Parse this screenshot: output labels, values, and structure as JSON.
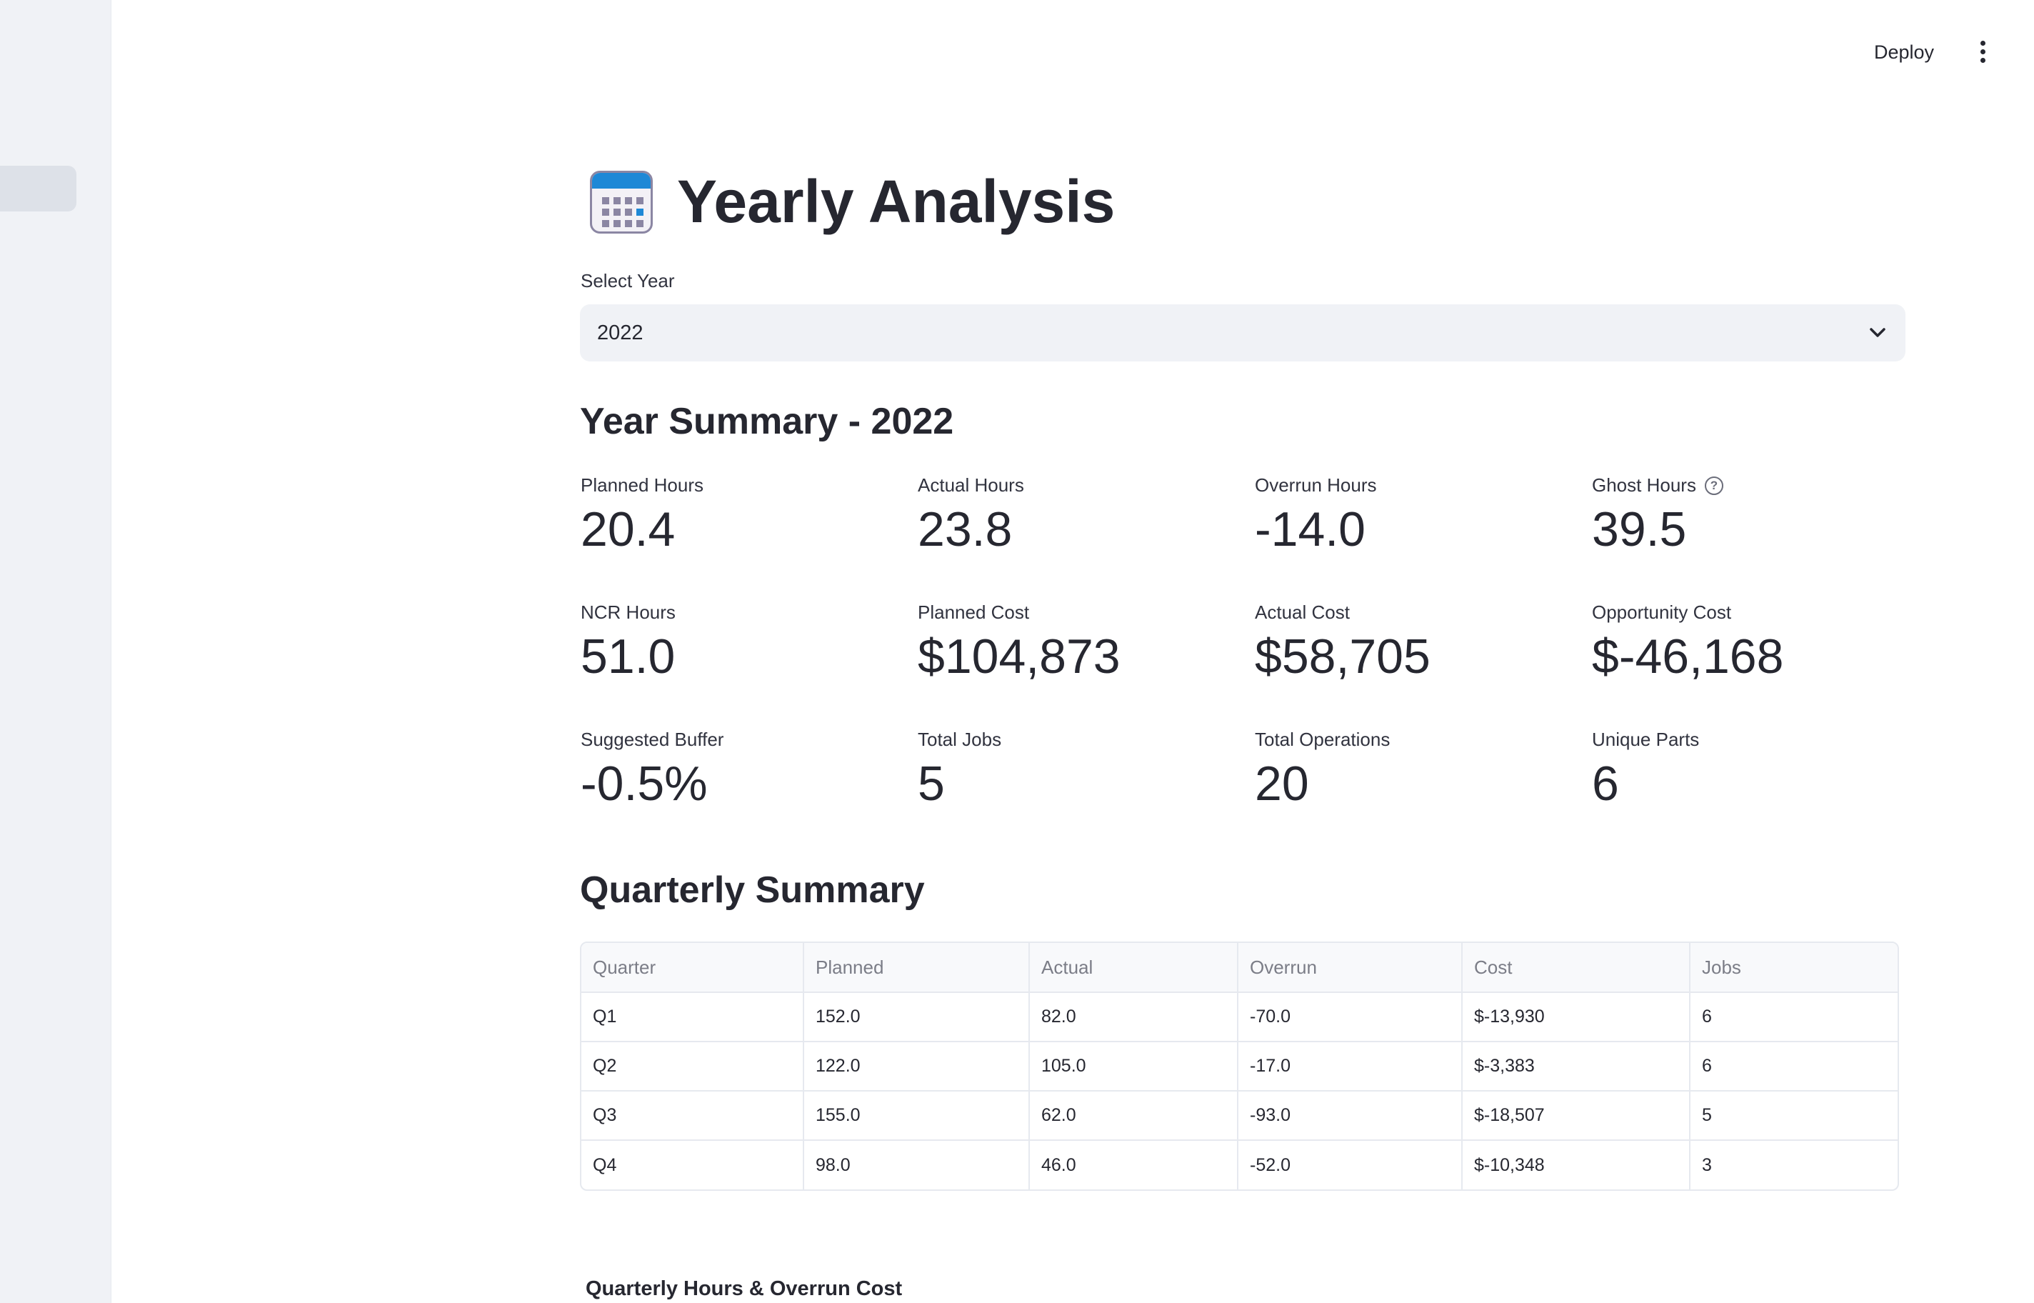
{
  "topbar": {
    "deploy_label": "Deploy",
    "menu_icon": "vertical-ellipsis-icon"
  },
  "page": {
    "title": "Yearly Analysis",
    "title_icon": "calendar-icon"
  },
  "year_select": {
    "label": "Select Year",
    "value": "2022"
  },
  "year_summary": {
    "heading": "Year Summary - 2022",
    "metrics": [
      {
        "label": "Planned Hours",
        "value": "20.4"
      },
      {
        "label": "Actual Hours",
        "value": "23.8"
      },
      {
        "label": "Overrun Hours",
        "value": "-14.0"
      },
      {
        "label": "Ghost Hours",
        "value": "39.5",
        "help": "?"
      },
      {
        "label": "NCR Hours",
        "value": "51.0"
      },
      {
        "label": "Planned Cost",
        "value": "$104,873"
      },
      {
        "label": "Actual Cost",
        "value": "$58,705"
      },
      {
        "label": "Opportunity Cost",
        "value": "$-46,168"
      },
      {
        "label": "Suggested Buffer",
        "value": "-0.5%"
      },
      {
        "label": "Total Jobs",
        "value": "5"
      },
      {
        "label": "Total Operations",
        "value": "20"
      },
      {
        "label": "Unique Parts",
        "value": "6"
      }
    ]
  },
  "quarterly_summary": {
    "heading": "Quarterly Summary",
    "columns": [
      "Quarter",
      "Planned",
      "Actual",
      "Overrun",
      "Cost",
      "Jobs"
    ],
    "rows": [
      [
        "Q1",
        "152.0",
        "82.0",
        "-70.0",
        "$-13,930",
        "6"
      ],
      [
        "Q2",
        "122.0",
        "105.0",
        "-17.0",
        "$-3,383",
        "6"
      ],
      [
        "Q3",
        "155.0",
        "62.0",
        "-93.0",
        "$-18,507",
        "5"
      ],
      [
        "Q4",
        "98.0",
        "46.0",
        "-52.0",
        "$-10,348",
        "3"
      ]
    ]
  },
  "chart_section": {
    "title": "Quarterly Hours & Overrun Cost"
  }
}
